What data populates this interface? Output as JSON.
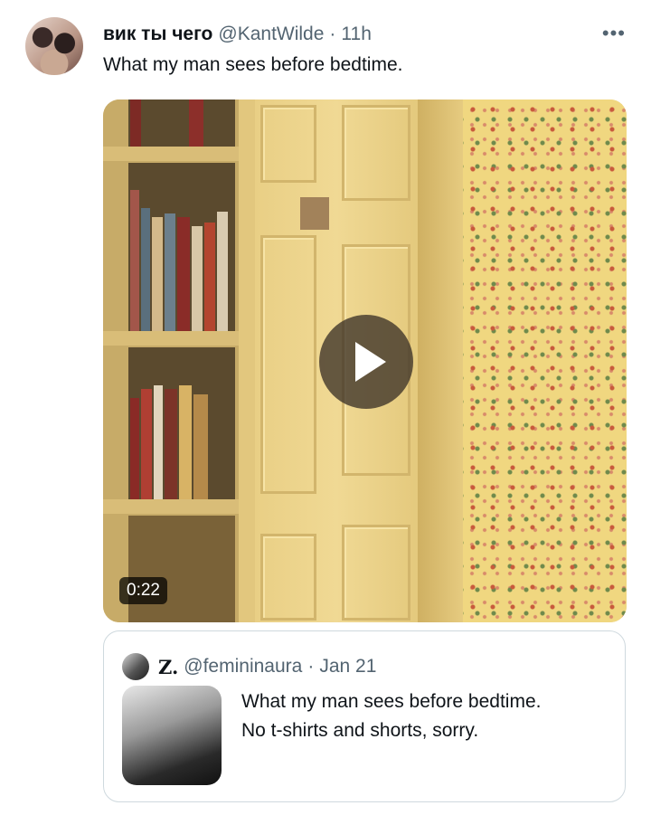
{
  "tweet": {
    "display_name": "вик ты чего",
    "handle": "@KantWilde",
    "separator": "·",
    "time": "11h",
    "more_icon": "more-horizontal-icon",
    "text": "What my man sees before bedtime."
  },
  "video": {
    "duration": "0:22",
    "play_icon": "play-icon"
  },
  "quoted_tweet": {
    "display_name": "Z.",
    "handle": "@femininaura",
    "separator": "·",
    "date": "Jan 21",
    "text_line1": "What my man sees before bedtime.",
    "text_line2": "No t-shirts and shorts, sorry."
  },
  "colors": {
    "text_primary": "#0f1419",
    "text_secondary": "#536471",
    "border": "#cfd9de"
  }
}
